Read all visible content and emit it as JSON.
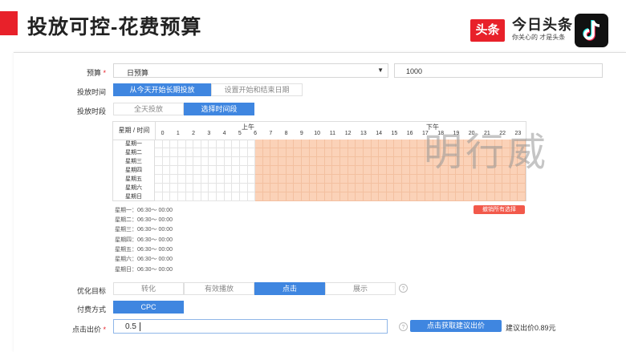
{
  "slide": {
    "title": "投放可控-花费预算"
  },
  "logos": {
    "toutiao_badge": "头条",
    "brand_name": "今日头条",
    "brand_slogan": "你关心的 才是头条",
    "tiktok_icon": "tiktok-note-icon"
  },
  "form": {
    "budget": {
      "label": "预算",
      "required_mark": "*",
      "type_value": "日预算",
      "amount": "1000",
      "dropdown_icon": "caret-down-icon"
    },
    "schedule_type": {
      "label": "投放时间",
      "options": [
        "从今天开始长期投放",
        "设置开始和结束日期"
      ],
      "selected_index": 0
    },
    "time_slot": {
      "label": "投放时段",
      "options": [
        "全天投放",
        "选择时间段"
      ],
      "selected_index": 1
    },
    "grid": {
      "corner": "星期 / 时间",
      "am": "上午",
      "pm": "下午",
      "hours": [
        "0",
        "1",
        "2",
        "3",
        "4",
        "5",
        "6",
        "7",
        "8",
        "9",
        "10",
        "11",
        "12",
        "13",
        "14",
        "15",
        "16",
        "17",
        "18",
        "19",
        "20",
        "21",
        "22",
        "23"
      ],
      "days": [
        "星期一",
        "星期二",
        "星期三",
        "星期四",
        "星期五",
        "星期六",
        "星期日"
      ],
      "selected_from_hour": 6.5,
      "selected_to_hour": 24
    },
    "schedule_lines": [
      "星期一：06:30～ 00:00",
      "星期二：06:30～ 00:00",
      "星期三：06:30～ 00:00",
      "星期四：06:30～ 00:00",
      "星期五：06:30～ 00:00",
      "星期六：06:30～ 00:00",
      "星期日：06:30～ 00:00"
    ],
    "clear_button": "撤销所有选择",
    "goal": {
      "label": "优化目标",
      "options": [
        "转化",
        "有效播放",
        "点击",
        "展示"
      ],
      "selected_index": 2,
      "help_icon": "question-circle-icon",
      "help_glyph": "?"
    },
    "pay": {
      "label": "付费方式",
      "option": "CPC"
    },
    "bid": {
      "label": "点击出价",
      "required_mark": "*",
      "value": "0.5",
      "help_glyph": "?",
      "suggest_button": "点击获取建议出价",
      "suggest_text": "建议出价0.89元"
    }
  },
  "watermark": "明行威",
  "colors": {
    "accent": "#3f86e0",
    "selected_cell": "#fbd2b8",
    "danger": "#f2594b",
    "brand_red": "#e8212a"
  }
}
